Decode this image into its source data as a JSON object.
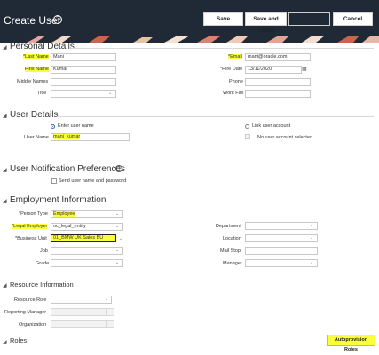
{
  "header": {
    "title": "Create User",
    "save_label": "Save",
    "save_close_label": "Save and Close",
    "blank_button_label": "",
    "cancel_label": "Cancel"
  },
  "personal": {
    "title": "Personal Details",
    "last_name_label": "*Last Name",
    "last_name_value": "Mani",
    "first_name_label": "First Name",
    "first_name_value": "Kumar",
    "middle_names_label": "Middle Names",
    "title_label": "Title",
    "email_label": "*Email",
    "email_value": "mani@oracle.com",
    "hire_date_label": "*Hire Date",
    "hire_date_value": "13/11/2020",
    "phone_label": "Phone",
    "work_fax_label": "Work Fax"
  },
  "user_details": {
    "title": "User Details",
    "enter_user_name_label": "Enter user name",
    "user_name_label": "User Name",
    "user_name_value": "mani_kumar",
    "link_user_account_label": "Link user account",
    "no_user_account_label": "No user account selected"
  },
  "notification": {
    "title": "User Notification Preferences",
    "send_label": "Send user name and password"
  },
  "employment": {
    "title": "Employment Information",
    "person_type_label": "*Person Type",
    "person_type_value": "Employee",
    "legal_employer_label": "*Legal Employer",
    "legal_employer_value": "oc_legal_entity",
    "business_unit_label": "*Business Unit",
    "business_unit_value": "01_BMW UK Sales BU",
    "job_label": "Job",
    "grade_label": "Grade",
    "department_label": "Department",
    "location_label": "Location",
    "mail_stop_label": "Mail Stop",
    "manager_label": "Manager"
  },
  "resource": {
    "title": "Resource Information",
    "resource_role_label": "Resource Role",
    "reporting_manager_label": "Reporting Manager",
    "organization_label": "Organization"
  },
  "roles": {
    "title": "Roles",
    "autoprovision_label": "Autoprovision Roles"
  },
  "icons": {
    "help": "help-icon",
    "calendar": "calendar-icon",
    "dropdown": "chevron-down-icon"
  },
  "colors": {
    "header_bg": "#1f2a36",
    "highlight": "#fbff3a"
  }
}
